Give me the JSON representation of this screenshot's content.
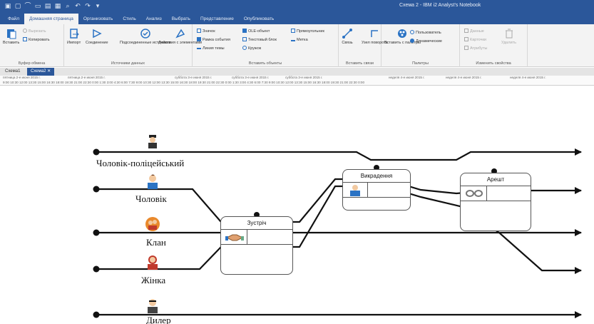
{
  "window": {
    "title": "Схема 2 - IBM i2 Analyst's Notebook"
  },
  "ribbon_tabs": [
    {
      "label": "Файл",
      "active": false
    },
    {
      "label": "Домашняя страница",
      "active": true
    },
    {
      "label": "Организовать",
      "active": false
    },
    {
      "label": "Стиль",
      "active": false
    },
    {
      "label": "Анализ",
      "active": false
    },
    {
      "label": "Выбрать",
      "active": false
    },
    {
      "label": "Представление",
      "active": false
    },
    {
      "label": "Опубликовать",
      "active": false
    }
  ],
  "ribbon": {
    "clipboard": {
      "paste": "Вставить",
      "cut": "Вырезать",
      "copy": "Копировать",
      "group": "Буфер обмена"
    },
    "data_sources": {
      "import": "Импорт",
      "connect": "Соединение",
      "connected_sources": "Подсоединенные источники",
      "actions": "Действия с элементами",
      "group": "Источники данных"
    },
    "insert_objects": {
      "icon": "Значок",
      "event_frame": "Рамка события",
      "timeline": "Линия темы",
      "ous_object": "OLE-объект",
      "text_block": "Текстовый блок",
      "circle": "Кружок",
      "rectangle": "Прямоугольник",
      "label": "Метка",
      "group": "Вставить объекты"
    },
    "insert_links": {
      "link": "Связь",
      "turn": "Узел поворота",
      "group": "Вставить связи"
    },
    "palettes": {
      "insert_from_palette": "Вставить с палитры",
      "custom": "Пользователь",
      "dynamic": "Динамические",
      "group": "Палитры"
    },
    "edit": {
      "data": "Данные",
      "cards": "Карточки",
      "attributes": "Атрибуты",
      "delete": "Удалить",
      "group": "Изменить свойства"
    }
  },
  "doc_tabs": [
    {
      "label": "Схема1",
      "active": false
    },
    {
      "label": "Схема2",
      "active": true
    }
  ],
  "ruler": {
    "dates": [
      "пятница 2-е июня 2015 г.",
      "пятница 2-е июня 2015 г.",
      "суббота 3-е июня 2015 г.",
      "суббота 3-е июня 2015 г.",
      "суббота 3-е июня 2015 г.",
      "неделя 4-е июня 2015 г.",
      "неделя 4-е июня 2015 г.",
      "неделя 4-е июня 2015 г."
    ],
    "times": "9:00  10:30  12:00  13:30  15:00  16:30  18:00  19:30  21:00  22:30  0:00  1:30  3:00  4:30  6:00  7:30  9:00  10:30  12:00  13:30  15:00  16:30  18:00  19:30  21:00  22:30  0:00  1:30  3:00  4:30  6:00  7:30  9:00  10:30  12:00  13:30  15:00  16:30  18:00  19:30  21:00  22:30  0:00"
  },
  "themes": [
    {
      "label": "Чоловік-поліцейський",
      "icon": "police-officer-icon"
    },
    {
      "label": "Чоловік",
      "icon": "man-icon"
    },
    {
      "label": "Клан",
      "icon": "clan-icon"
    },
    {
      "label": "Жінка",
      "icon": "woman-icon"
    },
    {
      "label": "Дилер",
      "icon": "dealer-icon"
    }
  ],
  "events": [
    {
      "title": "Зустріч",
      "icon": "handshake-icon"
    },
    {
      "title": "Викрадення",
      "icon": "person-icon"
    },
    {
      "title": "Арешт",
      "icon": "handcuffs-icon"
    }
  ],
  "colors": {
    "brand": "#2b579a",
    "ribbon_bg": "#f3f3f3",
    "line": "#111111"
  }
}
